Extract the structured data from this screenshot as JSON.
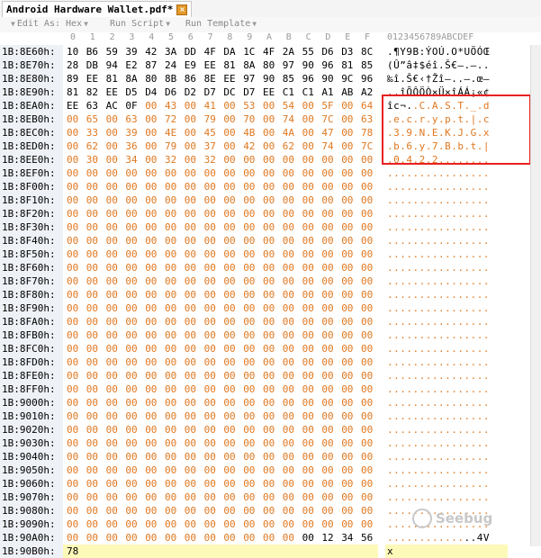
{
  "tab": {
    "title": "Android Hardware Wallet.pdf*",
    "close_icon": "close-icon"
  },
  "toolbar": {
    "edit_as": "Edit As: Hex",
    "run_script": "Run Script",
    "run_template": "Run Template"
  },
  "header": {
    "cols": [
      "0",
      "1",
      "2",
      "3",
      "4",
      "5",
      "6",
      "7",
      "8",
      "9",
      "A",
      "B",
      "C",
      "D",
      "E",
      "F"
    ],
    "ascii_ruler": "0123456789ABCDEF"
  },
  "rows": [
    {
      "addr": "1B:8E60h:",
      "hex": [
        "10",
        "B6",
        "59",
        "39",
        "42",
        "3A",
        "DD",
        "4F",
        "DA",
        "1C",
        "4F",
        "2A",
        "55",
        "D6",
        "D3",
        "8C"
      ],
      "ascii": ".¶Y9B:ÝOÚ.O*UÖÓŒ",
      "orange_from": -1
    },
    {
      "addr": "1B:8E70h:",
      "hex": [
        "28",
        "DB",
        "94",
        "E2",
        "87",
        "24",
        "E9",
        "EE",
        "81",
        "8A",
        "80",
        "97",
        "90",
        "96",
        "81",
        "85"
      ],
      "ascii": "(Û”â‡$éî.Š€—.–..",
      "orange_from": -1
    },
    {
      "addr": "1B:8E80h:",
      "hex": [
        "89",
        "EE",
        "81",
        "8A",
        "80",
        "8B",
        "86",
        "8E",
        "EE",
        "97",
        "90",
        "85",
        "96",
        "90",
        "9C",
        "96"
      ],
      "ascii": "‰î.Š€‹†Žî—..–.œ–",
      "orange_from": -1
    },
    {
      "addr": "1B:8E90h:",
      "hex": [
        "81",
        "82",
        "EE",
        "D5",
        "D4",
        "D6",
        "D2",
        "D7",
        "DC",
        "D7",
        "EE",
        "C1",
        "C1",
        "A1",
        "AB",
        "A2"
      ],
      "ascii": "..îÕÔÖÒ×Ü×îÁÁ¡«¢",
      "orange_from": -1
    },
    {
      "addr": "1B:8EA0h:",
      "hex": [
        "EE",
        "63",
        "AC",
        "0F",
        "00",
        "43",
        "00",
        "41",
        "00",
        "53",
        "00",
        "54",
        "00",
        "5F",
        "00",
        "64"
      ],
      "ascii": "îc¬..C.A.S.T._.d",
      "orange_from": 4
    },
    {
      "addr": "1B:8EB0h:",
      "hex": [
        "00",
        "65",
        "00",
        "63",
        "00",
        "72",
        "00",
        "79",
        "00",
        "70",
        "00",
        "74",
        "00",
        "7C",
        "00",
        "63"
      ],
      "ascii": ".e.c.r.y.p.t.|.c",
      "orange_from": 0
    },
    {
      "addr": "1B:8EC0h:",
      "hex": [
        "00",
        "33",
        "00",
        "39",
        "00",
        "4E",
        "00",
        "45",
        "00",
        "4B",
        "00",
        "4A",
        "00",
        "47",
        "00",
        "78"
      ],
      "ascii": ".3.9.N.E.K.J.G.x",
      "orange_from": 0
    },
    {
      "addr": "1B:8ED0h:",
      "hex": [
        "00",
        "62",
        "00",
        "36",
        "00",
        "79",
        "00",
        "37",
        "00",
        "42",
        "00",
        "62",
        "00",
        "74",
        "00",
        "7C"
      ],
      "ascii": ".b.6.y.7.B.b.t.|",
      "orange_from": 0
    },
    {
      "addr": "1B:8EE0h:",
      "hex": [
        "00",
        "30",
        "00",
        "34",
        "00",
        "32",
        "00",
        "32",
        "00",
        "00",
        "00",
        "00",
        "00",
        "00",
        "00",
        "00"
      ],
      "ascii": ".0.4.2.2........",
      "orange_from": 0
    },
    {
      "addr": "1B:8EF0h:",
      "hex": [
        "00",
        "00",
        "00",
        "00",
        "00",
        "00",
        "00",
        "00",
        "00",
        "00",
        "00",
        "00",
        "00",
        "00",
        "00",
        "00"
      ],
      "ascii": "................",
      "orange_from": 0
    },
    {
      "addr": "1B:8F00h:",
      "hex": [
        "00",
        "00",
        "00",
        "00",
        "00",
        "00",
        "00",
        "00",
        "00",
        "00",
        "00",
        "00",
        "00",
        "00",
        "00",
        "00"
      ],
      "ascii": "................",
      "orange_from": 0
    },
    {
      "addr": "1B:8F10h:",
      "hex": [
        "00",
        "00",
        "00",
        "00",
        "00",
        "00",
        "00",
        "00",
        "00",
        "00",
        "00",
        "00",
        "00",
        "00",
        "00",
        "00"
      ],
      "ascii": "................",
      "orange_from": 0
    },
    {
      "addr": "1B:8F20h:",
      "hex": [
        "00",
        "00",
        "00",
        "00",
        "00",
        "00",
        "00",
        "00",
        "00",
        "00",
        "00",
        "00",
        "00",
        "00",
        "00",
        "00"
      ],
      "ascii": "................",
      "orange_from": 0
    },
    {
      "addr": "1B:8F30h:",
      "hex": [
        "00",
        "00",
        "00",
        "00",
        "00",
        "00",
        "00",
        "00",
        "00",
        "00",
        "00",
        "00",
        "00",
        "00",
        "00",
        "00"
      ],
      "ascii": "................",
      "orange_from": 0
    },
    {
      "addr": "1B:8F40h:",
      "hex": [
        "00",
        "00",
        "00",
        "00",
        "00",
        "00",
        "00",
        "00",
        "00",
        "00",
        "00",
        "00",
        "00",
        "00",
        "00",
        "00"
      ],
      "ascii": "................",
      "orange_from": 0
    },
    {
      "addr": "1B:8F50h:",
      "hex": [
        "00",
        "00",
        "00",
        "00",
        "00",
        "00",
        "00",
        "00",
        "00",
        "00",
        "00",
        "00",
        "00",
        "00",
        "00",
        "00"
      ],
      "ascii": "................",
      "orange_from": 0
    },
    {
      "addr": "1B:8F60h:",
      "hex": [
        "00",
        "00",
        "00",
        "00",
        "00",
        "00",
        "00",
        "00",
        "00",
        "00",
        "00",
        "00",
        "00",
        "00",
        "00",
        "00"
      ],
      "ascii": "................",
      "orange_from": 0
    },
    {
      "addr": "1B:8F70h:",
      "hex": [
        "00",
        "00",
        "00",
        "00",
        "00",
        "00",
        "00",
        "00",
        "00",
        "00",
        "00",
        "00",
        "00",
        "00",
        "00",
        "00"
      ],
      "ascii": "................",
      "orange_from": 0
    },
    {
      "addr": "1B:8F80h:",
      "hex": [
        "00",
        "00",
        "00",
        "00",
        "00",
        "00",
        "00",
        "00",
        "00",
        "00",
        "00",
        "00",
        "00",
        "00",
        "00",
        "00"
      ],
      "ascii": "................",
      "orange_from": 0
    },
    {
      "addr": "1B:8F90h:",
      "hex": [
        "00",
        "00",
        "00",
        "00",
        "00",
        "00",
        "00",
        "00",
        "00",
        "00",
        "00",
        "00",
        "00",
        "00",
        "00",
        "00"
      ],
      "ascii": "................",
      "orange_from": 0
    },
    {
      "addr": "1B:8FA0h:",
      "hex": [
        "00",
        "00",
        "00",
        "00",
        "00",
        "00",
        "00",
        "00",
        "00",
        "00",
        "00",
        "00",
        "00",
        "00",
        "00",
        "00"
      ],
      "ascii": "................",
      "orange_from": 0
    },
    {
      "addr": "1B:8FB0h:",
      "hex": [
        "00",
        "00",
        "00",
        "00",
        "00",
        "00",
        "00",
        "00",
        "00",
        "00",
        "00",
        "00",
        "00",
        "00",
        "00",
        "00"
      ],
      "ascii": "................",
      "orange_from": 0
    },
    {
      "addr": "1B:8FC0h:",
      "hex": [
        "00",
        "00",
        "00",
        "00",
        "00",
        "00",
        "00",
        "00",
        "00",
        "00",
        "00",
        "00",
        "00",
        "00",
        "00",
        "00"
      ],
      "ascii": "................",
      "orange_from": 0
    },
    {
      "addr": "1B:8FD0h:",
      "hex": [
        "00",
        "00",
        "00",
        "00",
        "00",
        "00",
        "00",
        "00",
        "00",
        "00",
        "00",
        "00",
        "00",
        "00",
        "00",
        "00"
      ],
      "ascii": "................",
      "orange_from": 0
    },
    {
      "addr": "1B:8FE0h:",
      "hex": [
        "00",
        "00",
        "00",
        "00",
        "00",
        "00",
        "00",
        "00",
        "00",
        "00",
        "00",
        "00",
        "00",
        "00",
        "00",
        "00"
      ],
      "ascii": "................",
      "orange_from": 0
    },
    {
      "addr": "1B:8FF0h:",
      "hex": [
        "00",
        "00",
        "00",
        "00",
        "00",
        "00",
        "00",
        "00",
        "00",
        "00",
        "00",
        "00",
        "00",
        "00",
        "00",
        "00"
      ],
      "ascii": "................",
      "orange_from": 0
    },
    {
      "addr": "1B:9000h:",
      "hex": [
        "00",
        "00",
        "00",
        "00",
        "00",
        "00",
        "00",
        "00",
        "00",
        "00",
        "00",
        "00",
        "00",
        "00",
        "00",
        "00"
      ],
      "ascii": "................",
      "orange_from": 0
    },
    {
      "addr": "1B:9010h:",
      "hex": [
        "00",
        "00",
        "00",
        "00",
        "00",
        "00",
        "00",
        "00",
        "00",
        "00",
        "00",
        "00",
        "00",
        "00",
        "00",
        "00"
      ],
      "ascii": "................",
      "orange_from": 0
    },
    {
      "addr": "1B:9020h:",
      "hex": [
        "00",
        "00",
        "00",
        "00",
        "00",
        "00",
        "00",
        "00",
        "00",
        "00",
        "00",
        "00",
        "00",
        "00",
        "00",
        "00"
      ],
      "ascii": "................",
      "orange_from": 0
    },
    {
      "addr": "1B:9030h:",
      "hex": [
        "00",
        "00",
        "00",
        "00",
        "00",
        "00",
        "00",
        "00",
        "00",
        "00",
        "00",
        "00",
        "00",
        "00",
        "00",
        "00"
      ],
      "ascii": "................",
      "orange_from": 0
    },
    {
      "addr": "1B:9040h:",
      "hex": [
        "00",
        "00",
        "00",
        "00",
        "00",
        "00",
        "00",
        "00",
        "00",
        "00",
        "00",
        "00",
        "00",
        "00",
        "00",
        "00"
      ],
      "ascii": "................",
      "orange_from": 0
    },
    {
      "addr": "1B:9050h:",
      "hex": [
        "00",
        "00",
        "00",
        "00",
        "00",
        "00",
        "00",
        "00",
        "00",
        "00",
        "00",
        "00",
        "00",
        "00",
        "00",
        "00"
      ],
      "ascii": "................",
      "orange_from": 0
    },
    {
      "addr": "1B:9060h:",
      "hex": [
        "00",
        "00",
        "00",
        "00",
        "00",
        "00",
        "00",
        "00",
        "00",
        "00",
        "00",
        "00",
        "00",
        "00",
        "00",
        "00"
      ],
      "ascii": "................",
      "orange_from": 0
    },
    {
      "addr": "1B:9070h:",
      "hex": [
        "00",
        "00",
        "00",
        "00",
        "00",
        "00",
        "00",
        "00",
        "00",
        "00",
        "00",
        "00",
        "00",
        "00",
        "00",
        "00"
      ],
      "ascii": "................",
      "orange_from": 0
    },
    {
      "addr": "1B:9080h:",
      "hex": [
        "00",
        "00",
        "00",
        "00",
        "00",
        "00",
        "00",
        "00",
        "00",
        "00",
        "00",
        "00",
        "00",
        "00",
        "00",
        "00"
      ],
      "ascii": "................",
      "orange_from": 0
    },
    {
      "addr": "1B:9090h:",
      "hex": [
        "00",
        "00",
        "00",
        "00",
        "00",
        "00",
        "00",
        "00",
        "00",
        "00",
        "00",
        "00",
        "00",
        "00",
        "00",
        "00"
      ],
      "ascii": "................",
      "orange_from": 0
    },
    {
      "addr": "1B:90A0h:",
      "hex": [
        "00",
        "00",
        "00",
        "00",
        "00",
        "00",
        "00",
        "00",
        "00",
        "00",
        "00",
        "00",
        "00",
        "12",
        "34",
        "56"
      ],
      "ascii": "..............4V",
      "orange_from": 0,
      "orange_to": 12
    },
    {
      "addr": "1B:90B0h:",
      "hex": [
        "78",
        "",
        "",
        "",
        "",
        "",
        "",
        "",
        "",
        "",
        "",
        "",
        "",
        "",
        "",
        ""
      ],
      "ascii": "x",
      "orange_from": -1,
      "highlight": true
    }
  ],
  "selection_box_color": "#e82020",
  "watermark": "Seebug"
}
